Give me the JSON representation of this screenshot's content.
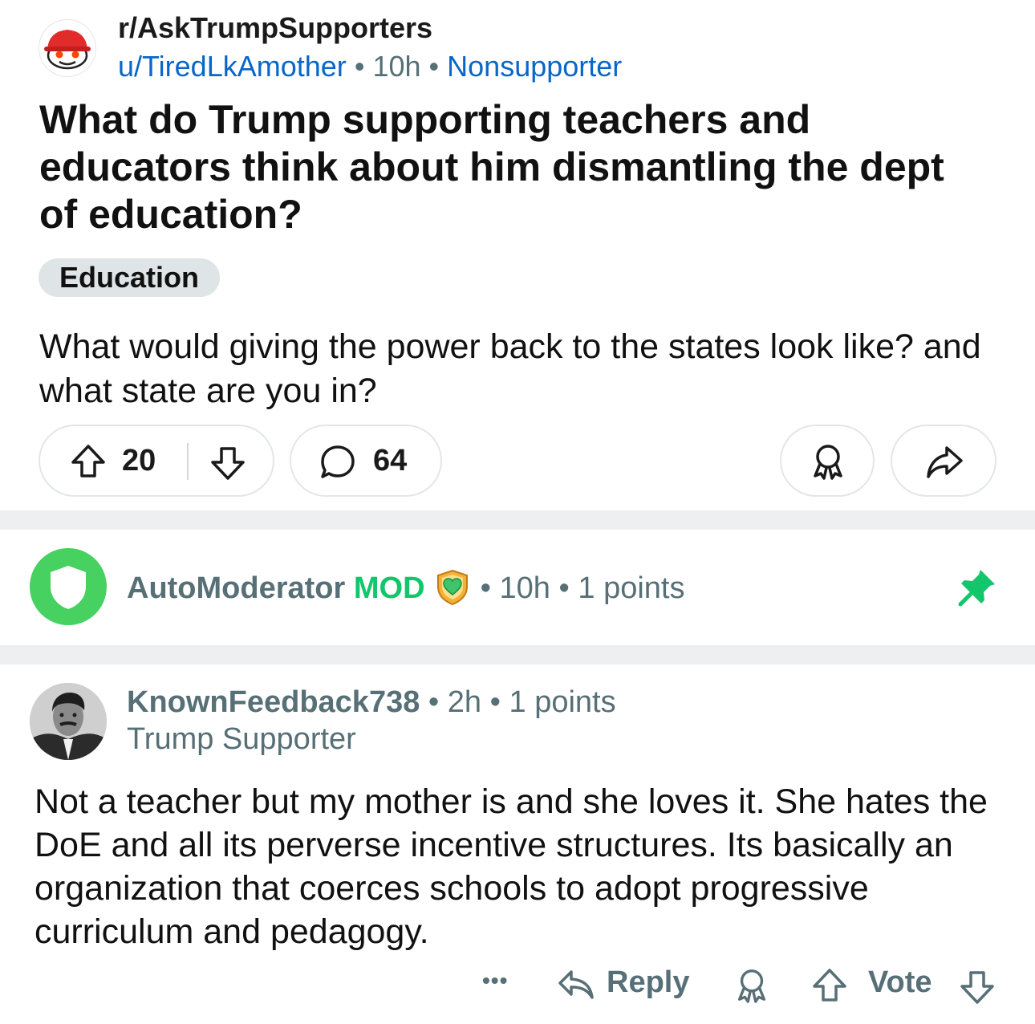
{
  "post": {
    "subreddit": "r/AskTrumpSupporters",
    "author": "u/TiredLkAmother",
    "age": "10h",
    "author_flair": "Nonsupporter",
    "separator": "•",
    "title": "What do Trump supporting teachers and educators think about him dismantling the dept of education?",
    "flair": "Education",
    "body": "What would giving the power back to the states look like? and what state are you in?",
    "upvotes": "20",
    "comments": "64"
  },
  "automod": {
    "name": "AutoModerator",
    "badge": "MOD",
    "age": "10h",
    "points": "1 points",
    "pinned_color": "#13c66b"
  },
  "comment": {
    "author": "KnownFeedback738",
    "age": "2h",
    "points": "1 points",
    "flair": "Trump Supporter",
    "text": "Not a teacher but my mother is and she loves it. She hates the DoE and all its perverse incentive structures. Its basically an organization that coerces schools to adopt progressive curriculum and pedagogy.",
    "more_label": "•••",
    "reply_label": "Reply",
    "vote_label": "Vote"
  },
  "colors": {
    "link": "#0a66c8",
    "muted": "#576f76",
    "automod_green": "#46d160",
    "mod_green": "#13c66b",
    "separator_gray": "#edeff1"
  }
}
